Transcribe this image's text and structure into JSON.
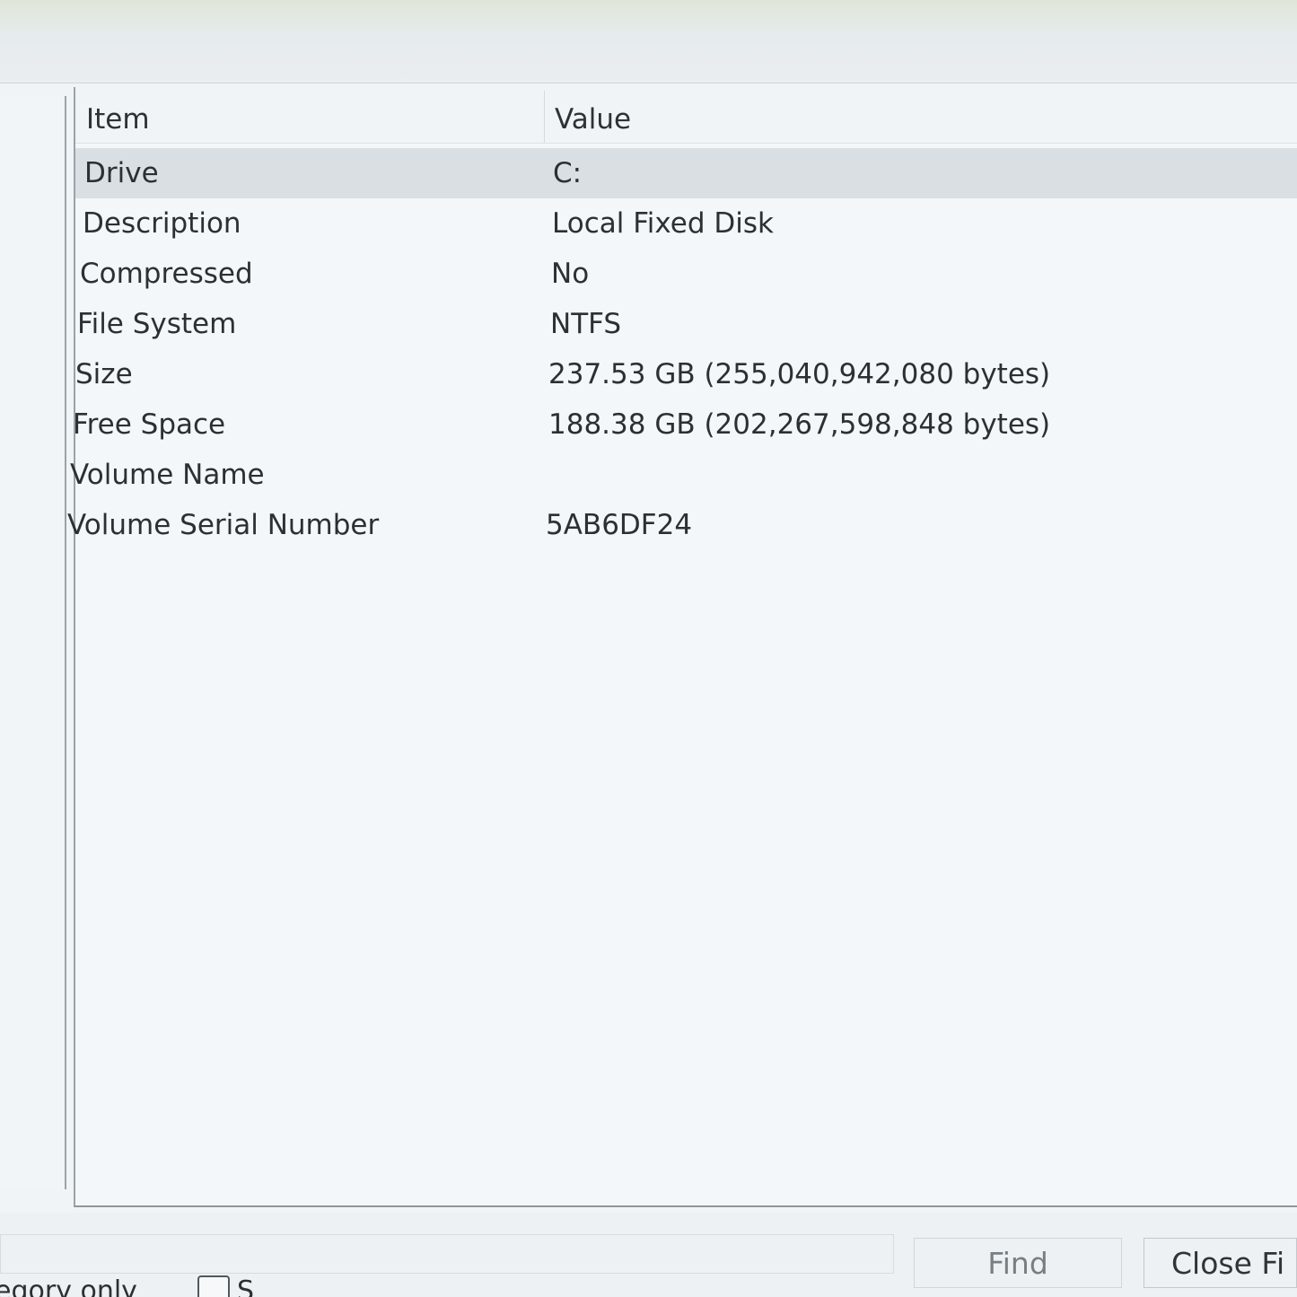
{
  "table": {
    "headers": {
      "item": "Item",
      "value": "Value"
    },
    "rows": [
      {
        "item": "Drive",
        "value": "C:"
      },
      {
        "item": "Description",
        "value": "Local Fixed Disk"
      },
      {
        "item": "Compressed",
        "value": "No"
      },
      {
        "item": "File System",
        "value": "NTFS"
      },
      {
        "item": "Size",
        "value": "237.53 GB (255,040,942,080 bytes)"
      },
      {
        "item": "Free Space",
        "value": "188.38 GB (202,267,598,848 bytes)"
      },
      {
        "item": "Volume Name",
        "value": ""
      },
      {
        "item": "Volume Serial Number",
        "value": "5AB6DF24"
      }
    ],
    "selected_row": 0
  },
  "find_bar": {
    "search_value": "",
    "find_label": "Find",
    "close_find_label": "Close Fi",
    "category_only_label": "egory only",
    "search_category_label": "S"
  }
}
